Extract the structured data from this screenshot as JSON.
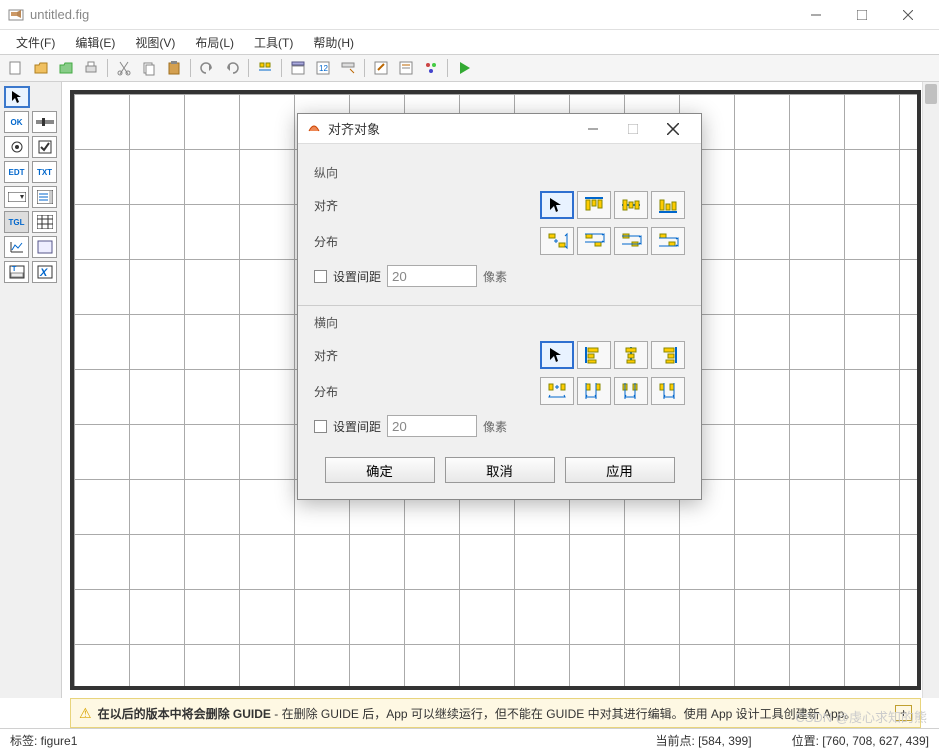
{
  "window": {
    "title": "untitled.fig"
  },
  "menu": {
    "file": "文件(F)",
    "edit": "编辑(E)",
    "view": "视图(V)",
    "layout": "布局(L)",
    "tools": "工具(T)",
    "help": "帮助(H)"
  },
  "palette": {
    "ok": "OK",
    "edt": "EDT",
    "txt": "TXT",
    "tgl": "TGL"
  },
  "dialog": {
    "title": "对齐对象",
    "vertical": {
      "section": "纵向",
      "align_label": "对齐",
      "distribute_label": "分布",
      "spacing_check": "设置间距",
      "spacing_value": "20",
      "spacing_suffix": "像素"
    },
    "horizontal": {
      "section": "横向",
      "align_label": "对齐",
      "distribute_label": "分布",
      "spacing_check": "设置间距",
      "spacing_value": "20",
      "spacing_suffix": "像素"
    },
    "buttons": {
      "ok": "确定",
      "cancel": "取消",
      "apply": "应用"
    }
  },
  "warning": {
    "bold": "在以后的版本中将会删除 GUIDE",
    "rest": " - 在删除 GUIDE 后，App 可以继续运行，但不能在 GUIDE 中对其进行编辑。使用 App 设计工具创建新 App。"
  },
  "status": {
    "tag_label": "标签: ",
    "tag_value": "figure1",
    "current_label": "当前点: ",
    "current_value": "[584, 399]",
    "position_label": "位置: ",
    "position_value": "[760, 708, 627, 439]"
  },
  "watermark": "CSDN @虔心求知的熊"
}
